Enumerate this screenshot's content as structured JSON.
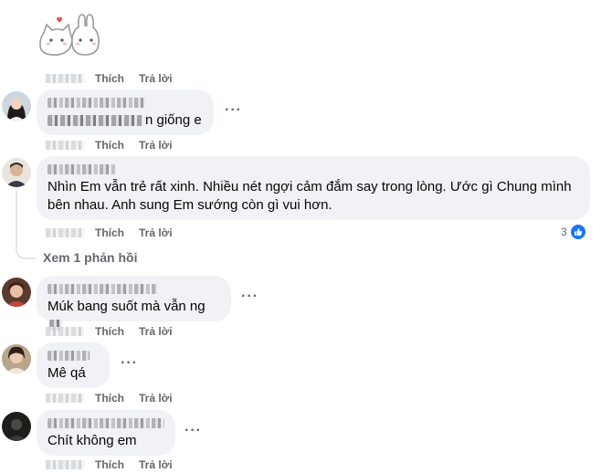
{
  "actions": {
    "like": "Thích",
    "reply": "Trả lời"
  },
  "comments": [
    {
      "text_suffix": "n giống e"
    },
    {
      "text": "Nhìn Em vẫn trẻ rất xinh. Nhiều nét ngợi cảm đắm say trong lòng. Ước gì Chung mình bên nhau. Anh sung Em sướng còn gì vui hơn.",
      "reaction_count": "3"
    },
    {
      "text": "Múk bang suốt mà vẫn ng"
    },
    {
      "text": "Mê qá"
    },
    {
      "text": "Chít không em"
    }
  ],
  "view_replies": "Xem 1 phản hồi",
  "more_glyph": "···",
  "colors": {
    "bubble": "#f0f2f5",
    "secondary_text": "#65676b",
    "like_blue": "#1877f2"
  }
}
